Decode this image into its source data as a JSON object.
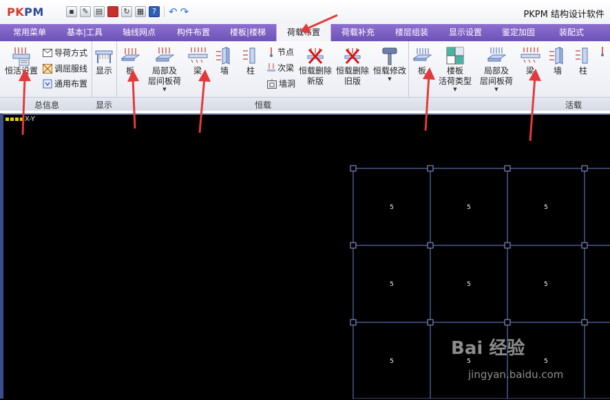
{
  "titlebar": {
    "logo_part1": "PK",
    "logo_part2": "PM",
    "app_title": "PKPM 结构设计软件"
  },
  "quick_access": [
    {
      "icon": "save-icon"
    },
    {
      "icon": "save-as-icon"
    },
    {
      "icon": "print-icon"
    },
    {
      "icon": "dwg-icon"
    },
    {
      "icon": "refresh-icon"
    },
    {
      "icon": "config-icon"
    },
    {
      "icon": "help-icon"
    },
    {
      "icon": "undo-icon"
    },
    {
      "icon": "redo-icon"
    }
  ],
  "tabs": [
    "常用菜单",
    "基本|工具",
    "轴线网点",
    "构件布置",
    "楼板|楼梯",
    "荷载布置",
    "荷载补充",
    "楼层组装",
    "显示设置",
    "鉴定加固",
    "装配式"
  ],
  "active_tab": "荷载布置",
  "ribbon": {
    "general_info": {
      "group_label": "总信息",
      "dead_live_settings": "恒活设置",
      "load_transfer": "导荷方式",
      "adjust_yield_line": "调屈服线",
      "general_layout": "通用布置"
    },
    "display": {
      "group_label": "显示",
      "display_btn": "显示"
    },
    "dead_load": {
      "group_label": "恒载",
      "slab": "板",
      "local_slab_line1": "局部及",
      "local_slab_line2": "层间板荷",
      "beam": "梁",
      "wall": "墙",
      "column": "柱",
      "node": "节点",
      "secondary_beam": "次梁",
      "wall_opening": "墙洞",
      "delete_new_line1": "恒载删除",
      "delete_new_line2": "新版",
      "delete_old_line1": "恒载删除",
      "delete_old_line2": "旧版",
      "modify": "恒载修改"
    },
    "live_load": {
      "group_label": "活载",
      "slab": "板",
      "slab_live_type_line1": "楼板",
      "slab_live_type_line2": "活荷类型",
      "local_slab_line1": "局部及",
      "local_slab_line2": "层间板荷",
      "beam": "梁",
      "wall": "墙",
      "column": "柱"
    }
  },
  "canvas": {
    "axis_indicator": "X-Y",
    "slab_label": "5"
  },
  "watermark": {
    "brand": "Bai 经验",
    "url": "jingyan.baidu.com"
  },
  "colors": {
    "tab_bar": "#7a5ec2",
    "grid_line": "#6f86d6",
    "canvas_bg": "#000000",
    "annotation_arrow": "#e23a3a"
  }
}
